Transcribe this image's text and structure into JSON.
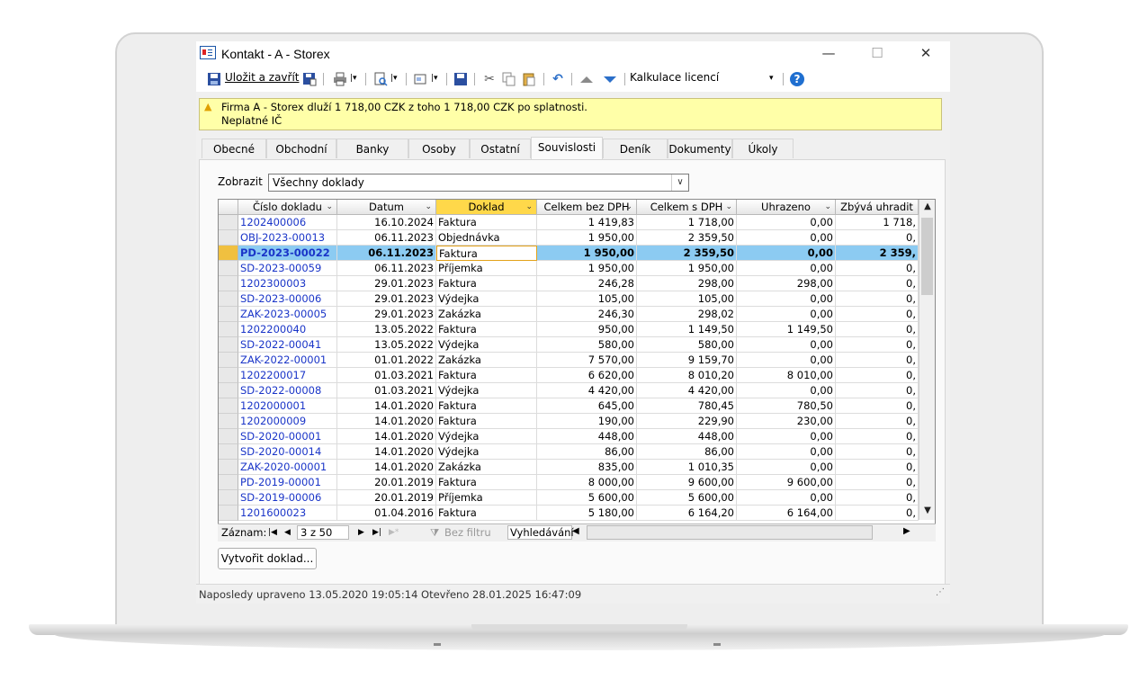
{
  "window": {
    "title": "Kontakt - A - Storex",
    "controls": {
      "minimize": "—",
      "maximize": "☐",
      "close": "✕"
    }
  },
  "toolbar": {
    "save_close_label": "Uložit a zavřít",
    "calc_label": "Kalkulace licencí",
    "help_icon": "?"
  },
  "warning": {
    "line1": "Firma A - Storex dluží 1 718,00 CZK z toho 1 718,00 CZK po splatnosti.",
    "line2": "Neplatné IČ"
  },
  "tabs": [
    {
      "label": "Obecné"
    },
    {
      "label": "Obchodní"
    },
    {
      "label": "Banky"
    },
    {
      "label": "Osoby"
    },
    {
      "label": "Ostatní"
    },
    {
      "label": "Souvislosti",
      "active": true
    },
    {
      "label": "Deník"
    },
    {
      "label": "Dokumenty"
    },
    {
      "label": "Úkoly"
    }
  ],
  "filter": {
    "label": "Zobrazit",
    "value": "Všechny doklady"
  },
  "grid": {
    "columns": [
      "Číslo dokladu",
      "Datum",
      "Doklad",
      "Celkem bez DPH",
      "Celkem s DPH",
      "Uhrazeno",
      "Zbývá uhradit"
    ],
    "sorted_column": "Doklad",
    "selected_row": 2,
    "rows": [
      {
        "cislo": "1202400006",
        "datum": "16.10.2024",
        "doklad": "Faktura",
        "bez": "1 419,83",
        "s": "1 718,00",
        "uhr": "0,00",
        "zbyva": "1 718,"
      },
      {
        "cislo": "OBJ-2023-00013",
        "datum": "06.11.2023",
        "doklad": "Objednávka",
        "bez": "1 950,00",
        "s": "2 359,50",
        "uhr": "0,00",
        "zbyva": "0,"
      },
      {
        "cislo": "PD-2023-00022",
        "datum": "06.11.2023",
        "doklad": "Faktura",
        "bez": "1 950,00",
        "s": "2 359,50",
        "uhr": "0,00",
        "zbyva": "2 359,"
      },
      {
        "cislo": "SD-2023-00059",
        "datum": "06.11.2023",
        "doklad": "Příjemka",
        "bez": "1 950,00",
        "s": "1 950,00",
        "uhr": "0,00",
        "zbyva": "0,"
      },
      {
        "cislo": "1202300003",
        "datum": "29.01.2023",
        "doklad": "Faktura",
        "bez": "246,28",
        "s": "298,00",
        "uhr": "298,00",
        "zbyva": "0,"
      },
      {
        "cislo": "SD-2023-00006",
        "datum": "29.01.2023",
        "doklad": "Výdejka",
        "bez": "105,00",
        "s": "105,00",
        "uhr": "0,00",
        "zbyva": "0,"
      },
      {
        "cislo": "ZAK-2023-00005",
        "datum": "29.01.2023",
        "doklad": "Zakázka",
        "bez": "246,30",
        "s": "298,02",
        "uhr": "0,00",
        "zbyva": "0,"
      },
      {
        "cislo": "1202200040",
        "datum": "13.05.2022",
        "doklad": "Faktura",
        "bez": "950,00",
        "s": "1 149,50",
        "uhr": "1 149,50",
        "zbyva": "0,"
      },
      {
        "cislo": "SD-2022-00041",
        "datum": "13.05.2022",
        "doklad": "Výdejka",
        "bez": "580,00",
        "s": "580,00",
        "uhr": "0,00",
        "zbyva": "0,"
      },
      {
        "cislo": "ZAK-2022-00001",
        "datum": "01.01.2022",
        "doklad": "Zakázka",
        "bez": "7 570,00",
        "s": "9 159,70",
        "uhr": "0,00",
        "zbyva": "0,"
      },
      {
        "cislo": "1202200017",
        "datum": "01.03.2021",
        "doklad": "Faktura",
        "bez": "6 620,00",
        "s": "8 010,20",
        "uhr": "8 010,00",
        "zbyva": "0,"
      },
      {
        "cislo": "SD-2022-00008",
        "datum": "01.03.2021",
        "doklad": "Výdejka",
        "bez": "4 420,00",
        "s": "4 420,00",
        "uhr": "0,00",
        "zbyva": "0,"
      },
      {
        "cislo": "1202000001",
        "datum": "14.01.2020",
        "doklad": "Faktura",
        "bez": "645,00",
        "s": "780,45",
        "uhr": "780,50",
        "zbyva": "0,"
      },
      {
        "cislo": "1202000009",
        "datum": "14.01.2020",
        "doklad": "Faktura",
        "bez": "190,00",
        "s": "229,90",
        "uhr": "230,00",
        "zbyva": "0,"
      },
      {
        "cislo": "SD-2020-00001",
        "datum": "14.01.2020",
        "doklad": "Výdejka",
        "bez": "448,00",
        "s": "448,00",
        "uhr": "0,00",
        "zbyva": "0,"
      },
      {
        "cislo": "SD-2020-00014",
        "datum": "14.01.2020",
        "doklad": "Výdejka",
        "bez": "86,00",
        "s": "86,00",
        "uhr": "0,00",
        "zbyva": "0,"
      },
      {
        "cislo": "ZAK-2020-00001",
        "datum": "14.01.2020",
        "doklad": "Zakázka",
        "bez": "835,00",
        "s": "1 010,35",
        "uhr": "0,00",
        "zbyva": "0,"
      },
      {
        "cislo": "PD-2019-00001",
        "datum": "20.01.2019",
        "doklad": "Faktura",
        "bez": "8 000,00",
        "s": "9 600,00",
        "uhr": "9 600,00",
        "zbyva": "0,"
      },
      {
        "cislo": "SD-2019-00006",
        "datum": "20.01.2019",
        "doklad": "Příjemka",
        "bez": "5 600,00",
        "s": "5 600,00",
        "uhr": "0,00",
        "zbyva": "0,"
      },
      {
        "cislo": "1201600023",
        "datum": "01.04.2016",
        "doklad": "Faktura",
        "bez": "5 180,00",
        "s": "6 164,20",
        "uhr": "6 164,00",
        "zbyva": "0,"
      }
    ]
  },
  "navigator": {
    "label": "Záznam:",
    "position": "3 z 50",
    "filter": "Bez filtru",
    "search": "Vyhledávání"
  },
  "create_button": "Vytvořit doklad...",
  "status": "Naposledy upraveno 13.05.2020 19:05:14 Otevřeno 28.01.2025 16:47:09",
  "colors": {
    "selected_row": "#8ccbf2",
    "sorted_header": "#ffd84a",
    "warning_bg": "#ffffa8",
    "link": "#1a35c8"
  }
}
